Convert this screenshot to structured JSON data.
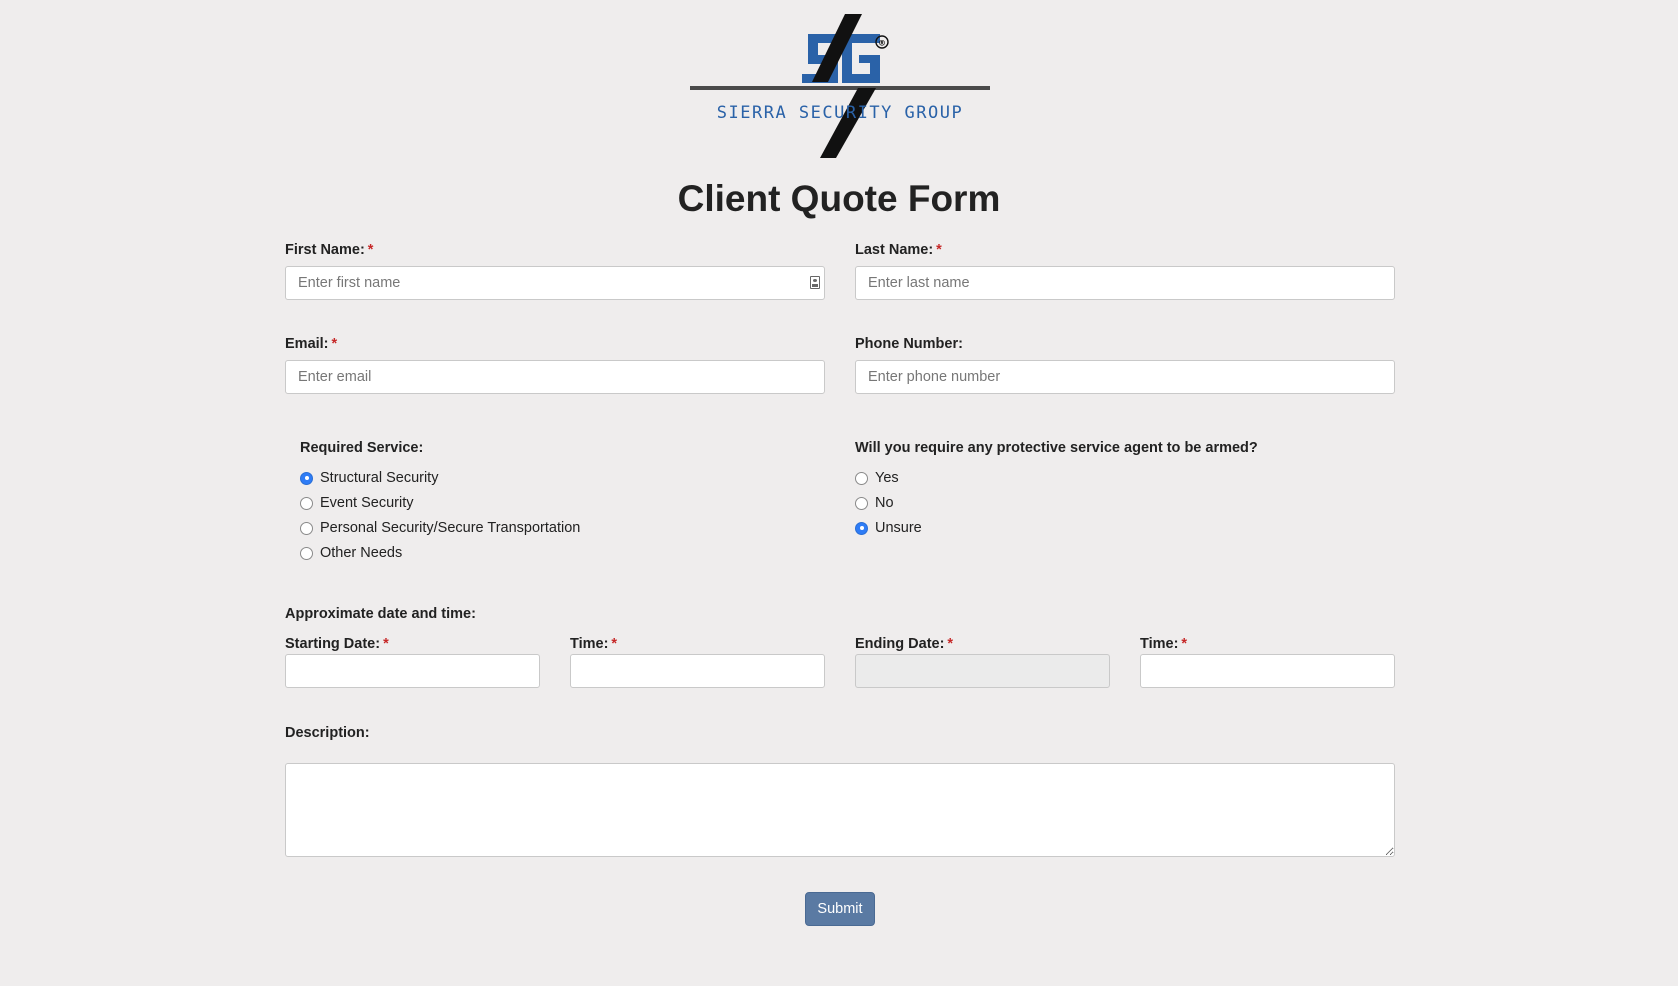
{
  "brand": {
    "monogram": "SG",
    "name": "SIERRA SECURITY GROUP",
    "registered_mark": "®",
    "colors": {
      "blue": "#2a62a8",
      "black": "#111111"
    }
  },
  "page": {
    "title": "Client Quote Form"
  },
  "required_marker": "*",
  "fields": {
    "first_name": {
      "label": "First Name:",
      "placeholder": "Enter first name",
      "value": ""
    },
    "last_name": {
      "label": "Last Name:",
      "placeholder": "Enter last name",
      "value": ""
    },
    "email": {
      "label": "Email:",
      "placeholder": "Enter email",
      "value": ""
    },
    "phone": {
      "label": "Phone Number:",
      "placeholder": "Enter phone number",
      "value": ""
    }
  },
  "required_service": {
    "label": "Required Service:",
    "options": [
      {
        "label": "Structural Security",
        "checked": true
      },
      {
        "label": "Event Security",
        "checked": false
      },
      {
        "label": "Personal Security/Secure Transportation",
        "checked": false
      },
      {
        "label": "Other Needs",
        "checked": false
      }
    ]
  },
  "armed_agent": {
    "label": "Will you require any protective service agent to be armed?",
    "options": [
      {
        "label": "Yes",
        "checked": false
      },
      {
        "label": "No",
        "checked": false
      },
      {
        "label": "Unsure",
        "checked": true
      }
    ]
  },
  "datetime": {
    "heading": "Approximate date and time:",
    "starting_date_label": "Starting Date:",
    "start_time_label": "Time:",
    "ending_date_label": "Ending Date:",
    "end_time_label": "Time:"
  },
  "description": {
    "label": "Description:",
    "value": ""
  },
  "submit_label": "Submit",
  "colors": {
    "accent": "#2e7cf6",
    "submit": "#5a7aa3",
    "required": "#c62828",
    "background": "#efeded"
  }
}
